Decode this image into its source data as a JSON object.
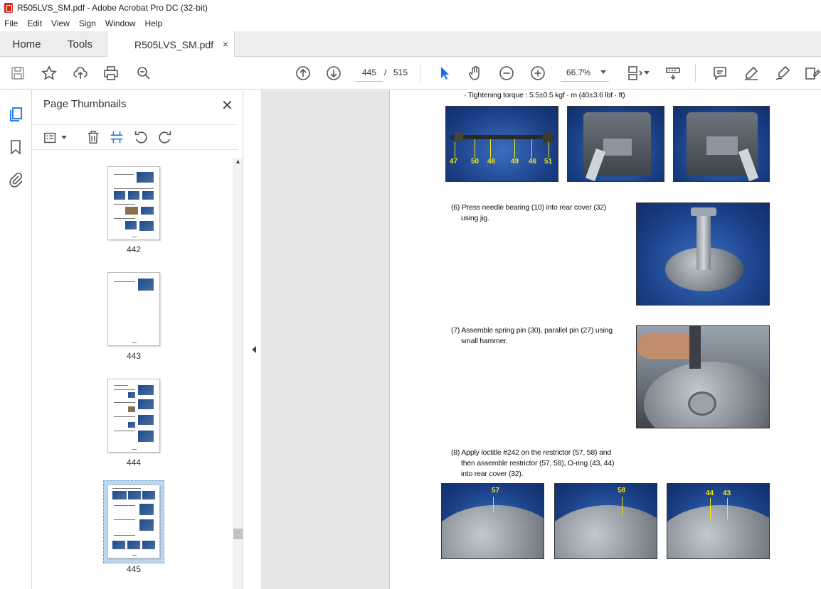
{
  "window": {
    "title": "R505LVS_SM.pdf - Adobe Acrobat Pro DC (32-bit)"
  },
  "menu": {
    "items": [
      "File",
      "Edit",
      "View",
      "Sign",
      "Window",
      "Help"
    ]
  },
  "tabs": {
    "home": "Home",
    "tools": "Tools",
    "document": "R505LVS_SM.pdf",
    "close": "×"
  },
  "toolbar": {
    "page_current": "445",
    "page_separator": "/",
    "page_total": "515",
    "zoom": "66.7%",
    "icons": [
      "save-icon",
      "star-icon",
      "upload-icon",
      "print-icon",
      "find-icon",
      "prev-page-icon",
      "next-page-icon",
      "select-arrow-icon",
      "hand-icon",
      "zoom-out-icon",
      "zoom-in-icon",
      "page-fit-icon",
      "scroll-mode-icon",
      "comment-icon",
      "highlight-icon",
      "sign-icon",
      "edit-pdf-icon"
    ]
  },
  "panel": {
    "title": "Page Thumbnails",
    "close": "✕",
    "thumbnails": [
      {
        "label": "442"
      },
      {
        "label": "443"
      },
      {
        "label": "444"
      },
      {
        "label": "445",
        "selected": true
      }
    ]
  },
  "document": {
    "torque_line": "· Tightening torque : 5.5±0.5 kgf · m (40±3.6 lbf · ft)",
    "callouts_top": [
      "47",
      "50",
      "48",
      "49",
      "46",
      "51"
    ],
    "step6_line1": "(6) Press needle bearing (10) into rear cover (32)",
    "step6_line2": "using jig.",
    "step7_line1": "(7) Assemble spring pin (30), parallel pin (27) using",
    "step7_line2": "small hammer.",
    "step8_line1": "(8) Apply loctitle #242 on the restrictor (57, 58) and",
    "step8_line2": "then assemble restrictor (57, 58), O-ring (43, 44)",
    "step8_line3": "into rear cover (32).",
    "callouts_bottom": [
      "57",
      "58",
      "44",
      "43"
    ]
  },
  "colors": {
    "accent": "#1473e6",
    "pdf_red": "#d9261c",
    "callout_yellow": "#f5e60a"
  }
}
